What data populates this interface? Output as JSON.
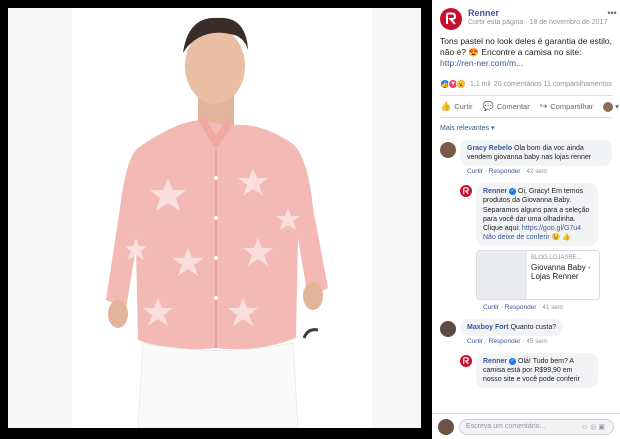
{
  "post": {
    "page_name": "Renner",
    "meta_prefix": "Curtir esta página",
    "meta_date": "18 de novembro de 2017",
    "text": "Tons pastel no look deles é garantia de estilo, não é? 😍 Encontre a camisa no site:",
    "url": "http://ren-ner.com/m..."
  },
  "stats": {
    "reaction_count": "1,1 mil",
    "right_text": "20 comentários  11 compartilhamentos",
    "reactions": [
      "like",
      "love",
      "wow"
    ]
  },
  "actions": {
    "like": "Curtir",
    "comment": "Comentar",
    "share": "Compartilhar"
  },
  "sort_label": "Mais relevantes ▾",
  "comments": [
    {
      "author": "Gracy Rebelo",
      "text": "Ola bom dia voc ainda vendem giovanna baby nas lojas renner",
      "like": "Curtir",
      "reply": "Responder",
      "time": "42 sem"
    },
    {
      "author": "Renner",
      "text": "Oi, Gracy! Em temos produtos da Giovanna Baby. Separamos alguns para a seleção para você dar uma olhadinha. Clique aqui:",
      "url": "https://goo.gl/G7u4 Não deixe de conferir 😉 👍",
      "card_domain": "BLOG.LOJASRE...",
      "card_title": "Giovanna Baby - Lojas Renner",
      "like": "Curtir",
      "reply": "Responder",
      "time": "41 sem"
    },
    {
      "author": "Maxboy Fort",
      "text": "Quanto custa?",
      "like": "Curtir",
      "reply": "Responder",
      "time": "45 sem"
    },
    {
      "author": "Renner",
      "text": "Olá! Tudo bem? A camisa está por R$99,90 em nosso site e você pode conferir",
      "like": "Curtir",
      "reply": "Responder",
      "time": ""
    }
  ],
  "composer": {
    "placeholder": "Escreva um comentário..."
  },
  "colors": {
    "brand": "#c8102e",
    "link": "#385898",
    "shirt": "#f3b9b5"
  }
}
